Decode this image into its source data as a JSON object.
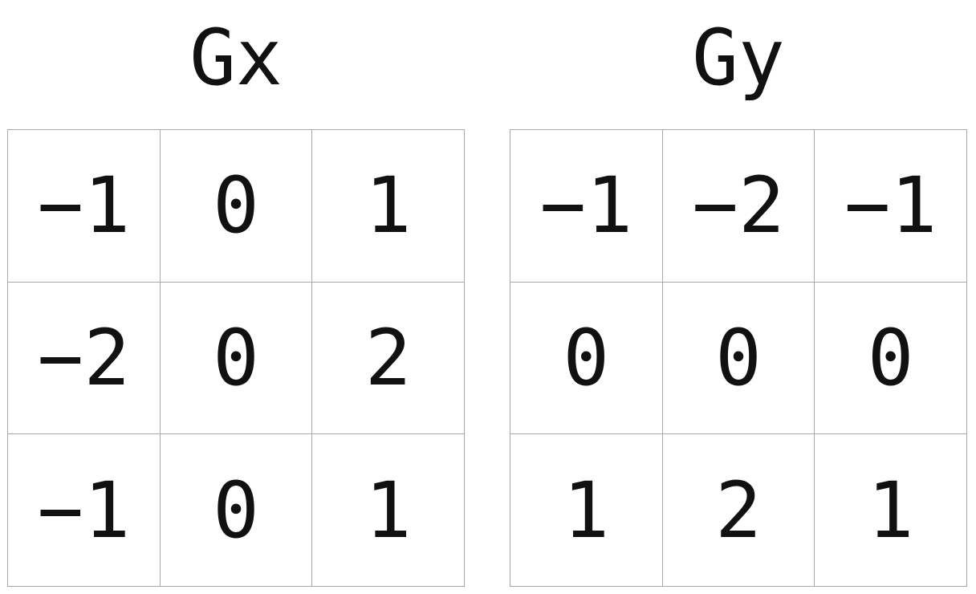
{
  "kernels": [
    {
      "title": "Gx",
      "rows": [
        [
          "−1",
          "0",
          "1"
        ],
        [
          "−2",
          "0",
          "2"
        ],
        [
          "−1",
          "0",
          "1"
        ]
      ]
    },
    {
      "title": "Gy",
      "rows": [
        [
          "−1",
          "−2",
          "−1"
        ],
        [
          "0",
          "0",
          "0"
        ],
        [
          "1",
          "2",
          "1"
        ]
      ]
    }
  ]
}
